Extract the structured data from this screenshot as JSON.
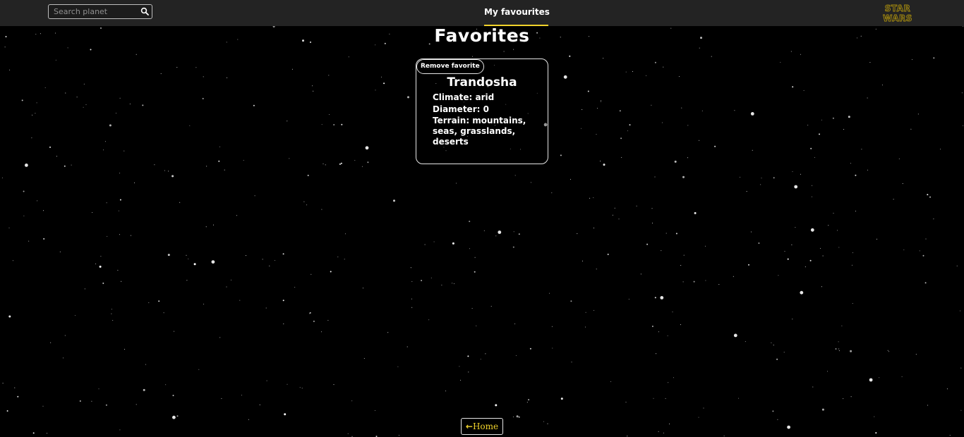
{
  "navbar": {
    "search": {
      "placeholder": "Search planet",
      "value": ""
    },
    "link_label": "My favourites",
    "logo_text_top": "STAR",
    "logo_text_bottom": "WARS"
  },
  "main": {
    "title": "Favorites",
    "favorites": [
      {
        "remove_label": "Remove favorite",
        "name": "Trandosha",
        "climate": "Climate: arid",
        "diameter": "Diameter: 0",
        "terrain": "Terrain: mountains, seas, grasslands, deserts"
      }
    ]
  },
  "footer": {
    "home_label": "Home"
  },
  "colors": {
    "background": "#000000",
    "navbar": "#232323",
    "accent": "#f1d32b",
    "border": "#e6e6e6"
  }
}
